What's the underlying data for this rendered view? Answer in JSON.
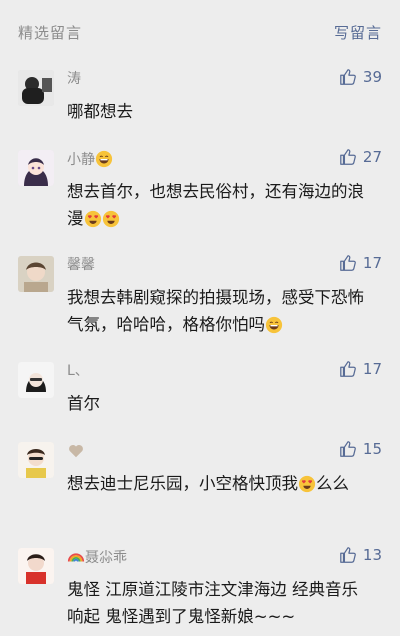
{
  "header": {
    "title": "精选留言",
    "write_label": "写留言"
  },
  "comments": [
    {
      "name": "涛",
      "likes": "39",
      "text": "哪都想去"
    },
    {
      "name": "小静",
      "likes": "27",
      "text": "想去首尔，也想去民俗村，还有海边的浪漫"
    },
    {
      "name": "馨馨",
      "likes": "17",
      "text": "我想去韩剧窥探的拍摄现场，感受下恐怖气氛，哈哈哈，格格你怕吗"
    },
    {
      "name": "L、",
      "likes": "17",
      "text": "首尔"
    },
    {
      "name": "",
      "likes": "15",
      "text_a": "想去迪士尼乐园，小空格快顶我",
      "text_b": "么么"
    },
    {
      "name": "聂尛乖",
      "likes": "13",
      "text": "鬼怪  江原道江陵市注文津海边 经典音乐响起 鬼怪遇到了鬼怪新娘~~~"
    }
  ],
  "colors": {
    "accent": "#576b95",
    "muted": "#8c8c8c",
    "background": "#ededed"
  },
  "icons": [
    "thumbs-up-icon",
    "grinning-face-emoji",
    "heart-eyes-emoji",
    "beige-heart-emoji",
    "rainbow-emoji"
  ]
}
